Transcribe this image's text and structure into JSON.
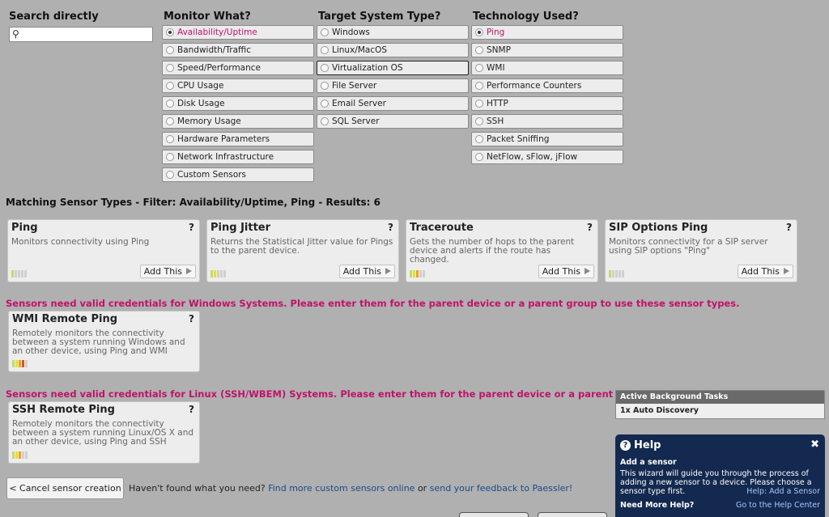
{
  "search": {
    "heading": "Search directly",
    "placeholder": ""
  },
  "columns": {
    "monitor": {
      "heading": "Monitor What?",
      "options": [
        "Availability/Uptime",
        "Bandwidth/Traffic",
        "Speed/Performance",
        "CPU Usage",
        "Disk Usage",
        "Memory Usage",
        "Hardware Parameters",
        "Network Infrastructure",
        "Custom Sensors"
      ],
      "selected": "Availability/Uptime"
    },
    "target": {
      "heading": "Target System Type?",
      "options": [
        "Windows",
        "Linux/MacOS",
        "Virtualization OS",
        "File Server",
        "Email Server",
        "SQL Server"
      ],
      "selected": ""
    },
    "tech": {
      "heading": "Technology Used?",
      "options": [
        "Ping",
        "SNMP",
        "WMI",
        "Performance Counters",
        "HTTP",
        "SSH",
        "Packet Sniffing",
        "NetFlow, sFlow, jFlow"
      ],
      "selected": "Ping"
    }
  },
  "matching": "Matching Sensor Types - Filter: Availability/Uptime, Ping - Results: 6",
  "cards": [
    {
      "title": "Ping",
      "desc": "Monitors connectivity using Ping",
      "add": "Add This",
      "meter": [
        "#c8d86a",
        "#d0d0d0",
        "#d0d0d0",
        "#d0d0d0",
        "#d0d0d0"
      ]
    },
    {
      "title": "Ping Jitter",
      "desc": "Returns the Statistical Jitter value for Pings to the parent device.",
      "add": "Add This",
      "meter": [
        "#c8d86a",
        "#e8e030",
        "#d0d0d0",
        "#d0d0d0",
        "#d0d0d0"
      ]
    },
    {
      "title": "Traceroute",
      "desc": "Gets the number of hops to the parent device and alerts if the route has changed.",
      "add": "Add This",
      "meter": [
        "#c8d86a",
        "#e8e030",
        "#f0a020",
        "#d0d0d0",
        "#d0d0d0"
      ]
    },
    {
      "title": "SIP Options Ping",
      "desc": "Monitors connectivity for a SIP server using SIP options \"Ping\"",
      "add": "Add This",
      "meter": [
        "#c8d86a",
        "#d0d0d0",
        "#d0d0d0",
        "#d0d0d0",
        "#d0d0d0"
      ]
    }
  ],
  "warnings": {
    "windows": "Sensors need valid credentials for Windows Systems. Please enter them for the parent device or a parent group to use these sensor types.",
    "linux": "Sensors need valid credentials for Linux (SSH/WBEM) Systems. Please enter them for the parent device or a parent group to use these sensor t"
  },
  "cred_cards": [
    {
      "title": "WMI Remote Ping",
      "desc": "Remotely monitors the connectivity between a system running Windows and an other device, using Ping and WMI",
      "meter": [
        "#c8d86a",
        "#e8e030",
        "#f0a020",
        "#e05020",
        "#d0d0d0"
      ]
    },
    {
      "title": "SSH Remote Ping",
      "desc": "Remotely monitors the connectivity between a system running Linux/OS X and an other device, using Ping and SSH",
      "meter": [
        "#c8d86a",
        "#e8e030",
        "#f0a020",
        "#d0d0d0",
        "#d0d0d0"
      ]
    }
  ],
  "cancel_label": "< Cancel sensor creation",
  "footer": {
    "prefix": "Haven't found what you need?",
    "link1": "Find more custom sensors online",
    "mid": "or",
    "link2": "send your feedback to Paessler!"
  },
  "bg_tasks": {
    "heading": "Active Background Tasks",
    "item": "1x Auto Discovery"
  },
  "help": {
    "heading": "Help",
    "close": "✖",
    "sub": "Add a sensor",
    "text": "This wizard will guide you through the process of adding a new sensor to a device. Please choose a sensor type first.",
    "link1": "Help: Add a Sensor",
    "need": "Need More Help?",
    "link2": "Go to the Help Center"
  },
  "colors": {
    "accent": "#c0126a",
    "help_bg": "#13294f"
  }
}
